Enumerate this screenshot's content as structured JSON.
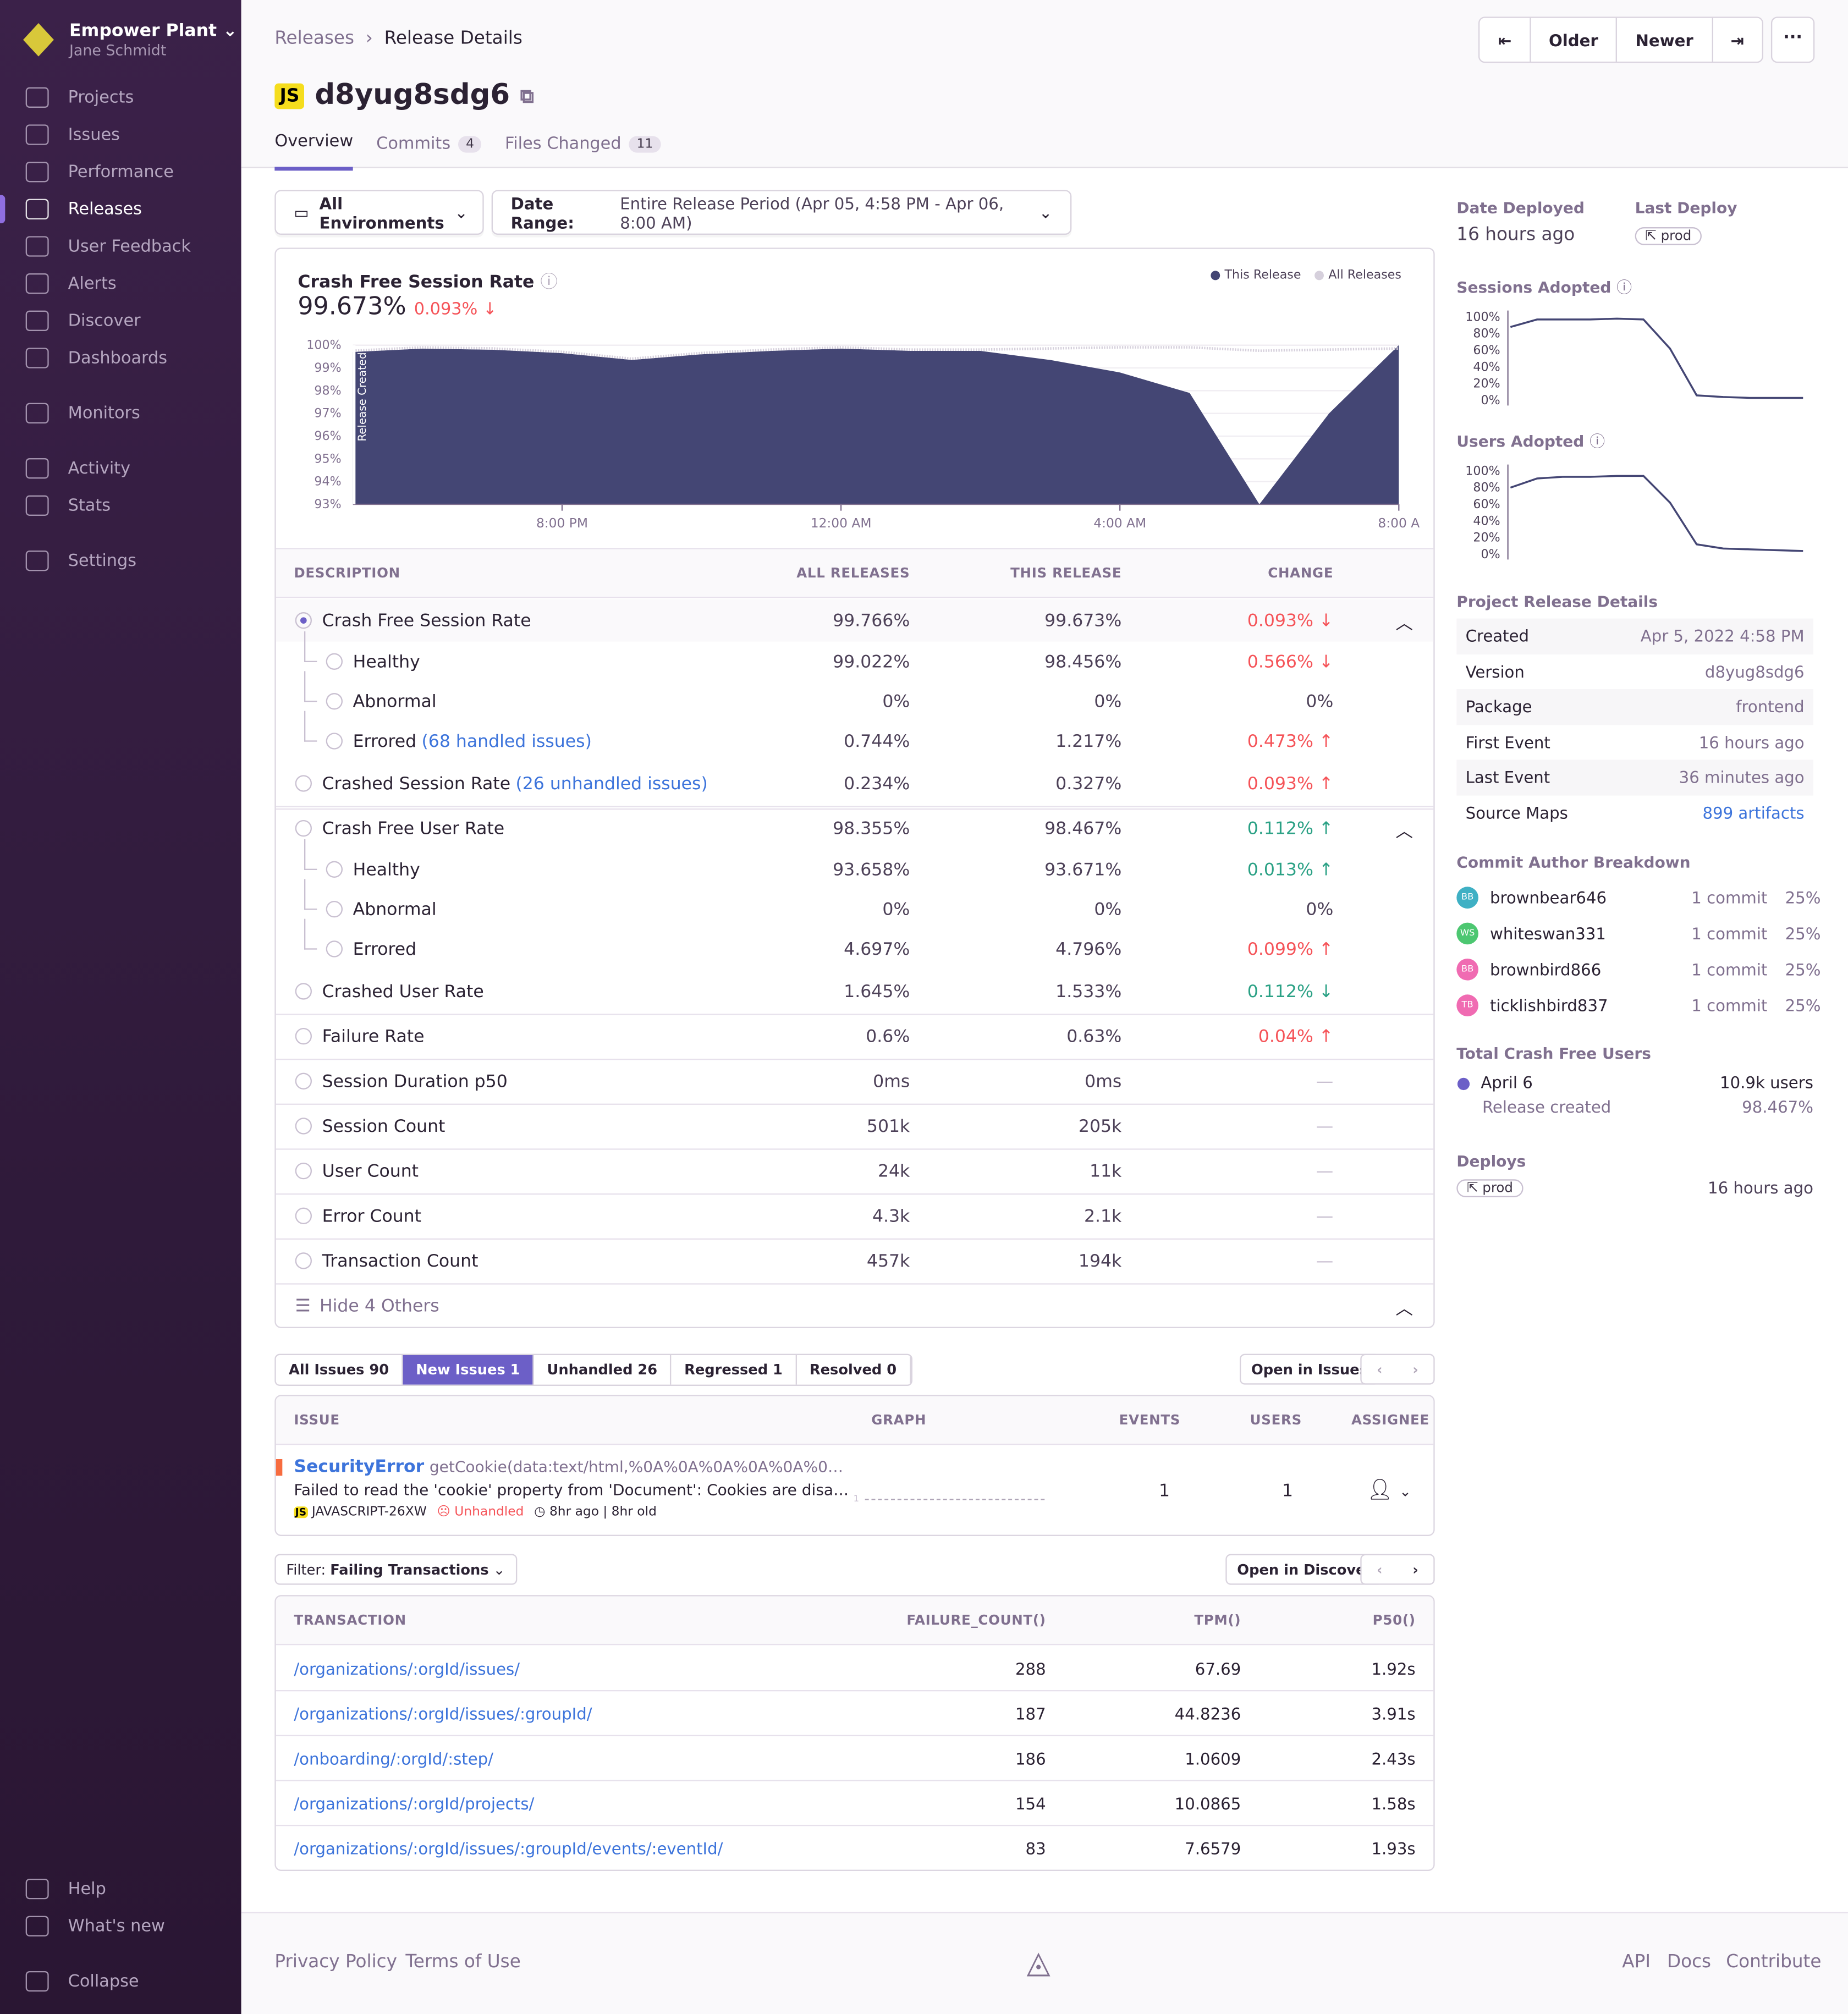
{
  "org": {
    "name": "Empower Plant",
    "user": "Jane Schmidt"
  },
  "sidebar": {
    "items": [
      {
        "label": "Projects",
        "icon": "projects-icon",
        "y": 62
      },
      {
        "label": "Issues",
        "icon": "issues-icon",
        "y": 91
      },
      {
        "label": "Performance",
        "icon": "performance-icon",
        "y": 120
      },
      {
        "label": "Releases",
        "icon": "releases-icon",
        "y": 149,
        "active": true
      },
      {
        "label": "User Feedback",
        "icon": "user-feedback-icon",
        "y": 178
      },
      {
        "label": "Alerts",
        "icon": "alerts-icon",
        "y": 207
      },
      {
        "label": "Discover",
        "icon": "discover-icon",
        "y": 236
      },
      {
        "label": "Dashboards",
        "icon": "dashboards-icon",
        "y": 265
      },
      {
        "label": "Monitors",
        "icon": "monitors-icon",
        "y": 308
      },
      {
        "label": "Activity",
        "icon": "activity-icon",
        "y": 351
      },
      {
        "label": "Stats",
        "icon": "stats-icon",
        "y": 380
      },
      {
        "label": "Settings",
        "icon": "settings-icon",
        "y": 423
      },
      {
        "label": "Help",
        "icon": "help-icon",
        "y": 1458
      },
      {
        "label": "What's new",
        "icon": "broadcast-icon",
        "y": 1487
      },
      {
        "label": "Collapse",
        "icon": "collapse-icon",
        "y": 1530
      }
    ]
  },
  "header": {
    "breadcrumb": [
      "Releases",
      "Release Details"
    ],
    "platform": "JS",
    "title": "d8yug8sdg6",
    "tabs": [
      {
        "label": "Overview",
        "active": true
      },
      {
        "label": "Commits",
        "count": "4"
      },
      {
        "label": "Files Changed",
        "count": "11"
      }
    ],
    "nav": {
      "older": "Older",
      "newer": "Newer",
      "more": "···"
    }
  },
  "filters": {
    "environment": "All Environments",
    "date_label": "Date Range:",
    "date_value": "Entire Release Period (Apr 05, 4:58 PM - Apr 06, 8:00 AM)"
  },
  "chart": {
    "title": "Crash Free Session Rate",
    "value": "99.673%",
    "change": "0.093% ↓",
    "legend": [
      "This Release",
      "All Releases"
    ],
    "marker": "Release Created",
    "colors": {
      "this": "#444674",
      "all": "#d6d0dc"
    }
  },
  "chart_data": {
    "type": "area",
    "x": [
      "5:00 PM",
      "6:00 PM",
      "7:00 PM",
      "8:00 PM",
      "9:00 PM",
      "10:00 PM",
      "11:00 PM",
      "12:00 AM",
      "1:00 AM",
      "2:00 AM",
      "3:00 AM",
      "4:00 AM",
      "5:00 AM",
      "6:00 AM",
      "7:00 AM",
      "8:00 AM"
    ],
    "series": [
      {
        "name": "This Release",
        "values": [
          99.7,
          99.85,
          99.8,
          99.65,
          99.35,
          99.6,
          99.75,
          99.85,
          99.75,
          99.75,
          99.35,
          98.8,
          97.9,
          93.0,
          97.0,
          100
        ]
      },
      {
        "name": "All Releases",
        "values": [
          99.7,
          99.85,
          99.8,
          99.65,
          99.35,
          99.6,
          99.75,
          99.85,
          99.75,
          99.75,
          99.8,
          99.85,
          99.85,
          99.7,
          99.75,
          99.8
        ]
      }
    ],
    "y_ticks": [
      "100%",
      "99%",
      "98%",
      "97%",
      "96%",
      "95%",
      "94%",
      "93%"
    ],
    "x_ticks": [
      "8:00 PM",
      "12:00 AM",
      "4:00 AM",
      "8:00 A"
    ],
    "ylim": [
      93,
      100
    ]
  },
  "metrics": {
    "headers": [
      "DESCRIPTION",
      "ALL RELEASES",
      "THIS RELEASE",
      "CHANGE"
    ],
    "rows": [
      {
        "label": "Crash Free Session Rate",
        "all": "99.766%",
        "this": "99.673%",
        "change": "0.093% ↓",
        "tone": "red",
        "selected": true,
        "chevron": true,
        "top": 466,
        "h": 33
      },
      {
        "label": "Healthy",
        "all": "99.022%",
        "this": "98.456%",
        "change": "0.566% ↓",
        "tone": "red",
        "child": true,
        "top": 499
      },
      {
        "label": "Abnormal",
        "all": "0%",
        "this": "0%",
        "change": "0%",
        "tone": "",
        "child": true,
        "top": 530
      },
      {
        "label": "Errored",
        "link": "(68 handled issues)",
        "all": "0.744%",
        "this": "1.217%",
        "change": "0.473% ↑",
        "tone": "red",
        "child": true,
        "top": 561
      },
      {
        "label": "Crashed Session Rate",
        "link": "(26 unhandled issues)",
        "all": "0.234%",
        "this": "0.327%",
        "change": "0.093% ↑",
        "tone": "red",
        "top": 594,
        "sepAfter": true
      },
      {
        "label": "Crash Free User Rate",
        "all": "98.355%",
        "this": "98.467%",
        "change": "0.112% ↑",
        "tone": "green",
        "chevron": true,
        "top": 629
      },
      {
        "label": "Healthy",
        "all": "93.658%",
        "this": "93.671%",
        "change": "0.013% ↑",
        "tone": "green",
        "child": true,
        "top": 661
      },
      {
        "label": "Abnormal",
        "all": "0%",
        "this": "0%",
        "change": "0%",
        "tone": "",
        "child": true,
        "top": 692
      },
      {
        "label": "Errored",
        "all": "4.697%",
        "this": "4.796%",
        "change": "0.099% ↑",
        "tone": "red",
        "child": true,
        "top": 723
      },
      {
        "label": "Crashed User Rate",
        "all": "1.645%",
        "this": "1.533%",
        "change": "0.112% ↓",
        "tone": "green",
        "top": 756,
        "sepAfter": true
      },
      {
        "label": "Failure Rate",
        "all": "0.6%",
        "this": "0.63%",
        "change": "0.04% ↑",
        "tone": "red",
        "top": 791,
        "sepAfter": true
      },
      {
        "label": "Session Duration p50",
        "all": "0ms",
        "this": "0ms",
        "change": "—",
        "tone": "muted",
        "top": 826,
        "sepAfter": true
      },
      {
        "label": "Session Count",
        "all": "501k",
        "this": "205k",
        "change": "—",
        "tone": "muted",
        "top": 861,
        "sepAfter": true
      },
      {
        "label": "User Count",
        "all": "24k",
        "this": "11k",
        "change": "—",
        "tone": "muted",
        "top": 896,
        "sepAfter": true
      },
      {
        "label": "Error Count",
        "all": "4.3k",
        "this": "2.1k",
        "change": "—",
        "tone": "muted",
        "top": 931,
        "sepAfter": true
      },
      {
        "label": "Transaction Count",
        "all": "457k",
        "this": "194k",
        "change": "—",
        "tone": "muted",
        "top": 966,
        "sepAfter": true
      }
    ],
    "toggle": "Hide 4 Others"
  },
  "issues": {
    "tabs": [
      {
        "label": "All Issues 90"
      },
      {
        "label": "New Issues 1",
        "active": true
      },
      {
        "label": "Unhandled 26"
      },
      {
        "label": "Regressed 1"
      },
      {
        "label": "Resolved 0"
      }
    ],
    "open": "Open in Issues",
    "headers": [
      "ISSUE",
      "GRAPH",
      "EVENTS",
      "USERS",
      "ASSIGNEE"
    ],
    "rows": [
      {
        "type": "SecurityError",
        "culprit": "getCookie(data:text/html,%0A%0A%0A%0A%0A%0…",
        "message": "Failed to read the 'cookie' property from 'Document': Cookies are disa…",
        "platform": "JS",
        "short_id": "JAVASCRIPT-26XW",
        "handled": "Unhandled",
        "age": "8hr ago | 8hr old",
        "graph_label": "1",
        "events": "1",
        "users": "1"
      }
    ]
  },
  "transactions": {
    "filter_label": "Filter:",
    "filter_value": "Failing Transactions",
    "open": "Open in Discover",
    "headers": [
      "TRANSACTION",
      "FAILURE_COUNT()",
      "TPM()",
      "P50()"
    ],
    "rows": [
      {
        "name": "/organizations/:orgId/issues/",
        "failure": "288",
        "tpm": "67.69",
        "p50": "1.92s"
      },
      {
        "name": "/organizations/:orgId/issues/:groupId/",
        "failure": "187",
        "tpm": "44.8236",
        "p50": "3.91s"
      },
      {
        "name": "/onboarding/:orgId/:step/",
        "failure": "186",
        "tpm": "1.0609",
        "p50": "2.43s"
      },
      {
        "name": "/organizations/:orgId/projects/",
        "failure": "154",
        "tpm": "10.0865",
        "p50": "1.58s"
      },
      {
        "name": "/organizations/:orgId/issues/:groupId/events/:eventId/",
        "failure": "83",
        "tpm": "7.6579",
        "p50": "1.93s"
      }
    ]
  },
  "side": {
    "date_deployed_label": "Date Deployed",
    "date_deployed": "16 hours ago",
    "last_deploy_label": "Last Deploy",
    "last_deploy_env": "prod",
    "sessions_adopted": "Sessions Adopted",
    "users_adopted": "Users Adopted",
    "adopt_ticks": [
      "100%",
      "80%",
      "60%",
      "40%",
      "20%",
      "0%"
    ],
    "sessions_series": [
      88,
      97,
      97,
      97,
      98,
      97,
      62,
      6,
      4,
      3,
      3,
      3
    ],
    "users_series": [
      80,
      91,
      93,
      93,
      94,
      94,
      62,
      12,
      7,
      6,
      5,
      4
    ],
    "details_title": "Project Release Details",
    "details": [
      {
        "k": "Created",
        "v": "Apr 5, 2022 4:58 PM"
      },
      {
        "k": "Version",
        "v": "d8yug8sdg6"
      },
      {
        "k": "Package",
        "v": "frontend"
      },
      {
        "k": "First Event",
        "v": "16 hours ago"
      },
      {
        "k": "Last Event",
        "v": "36 minutes ago"
      },
      {
        "k": "Source Maps",
        "v": "899 artifacts",
        "link": true
      }
    ],
    "authors_title": "Commit Author Breakdown",
    "authors": [
      {
        "initials": "BB",
        "name": "brownbear646",
        "commits": "1 commit",
        "pct": "25%",
        "color": "#3fb0c4"
      },
      {
        "initials": "WS",
        "name": "whiteswan331",
        "commits": "1 commit",
        "pct": "25%",
        "color": "#4dc771"
      },
      {
        "initials": "BB",
        "name": "brownbird866",
        "commits": "1 commit",
        "pct": "25%",
        "color": "#f06bb2"
      },
      {
        "initials": "TB",
        "name": "ticklishbird837",
        "commits": "1 commit",
        "pct": "25%",
        "color": "#f06bb2"
      }
    ],
    "crash_free_title": "Total Crash Free Users",
    "crash_date": "April 6",
    "crash_users": "10.9k users",
    "crash_note": "Release created",
    "crash_pct": "98.467%",
    "deploys_title": "Deploys",
    "deploy_env": "prod",
    "deploy_time": "16 hours ago"
  },
  "footer": {
    "left": [
      "Privacy Policy",
      "Terms of Use"
    ],
    "right": [
      "API",
      "Docs",
      "Contribute"
    ]
  }
}
